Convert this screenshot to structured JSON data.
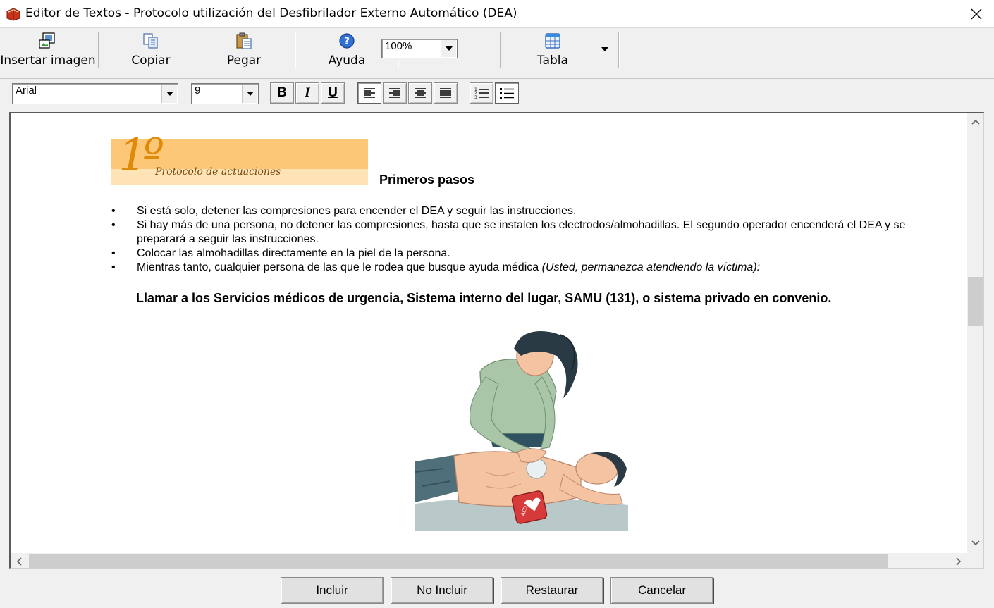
{
  "window": {
    "title": "Editor de Textos - Protocolo utilización del Desfibrilador Externo Automático (DEA)",
    "close_icon": "close-icon"
  },
  "toolbar": {
    "insert_image_label": "Insertar imagen",
    "copy_label": "Copiar",
    "paste_label": "Pegar",
    "help_label": "Ayuda",
    "zoom_value": "100%",
    "table_label": "Tabla"
  },
  "format": {
    "font_family": "Arial",
    "font_size": "9",
    "bold_label": "B",
    "italic_label": "I",
    "underline_label": "U"
  },
  "document": {
    "banner_number": "1º",
    "banner_subtitle": "Protocolo de actuaciones",
    "heading": "Primeros pasos",
    "bullets": [
      "Si está solo, detener las compresiones para encender el DEA y seguir las instrucciones.",
      "Si hay más de una persona, no detener las compresiones, hasta que se instalen los electrodos/almohadillas. El segundo operador encenderá el DEA y se preparará a seguir las instrucciones.",
      "Colocar las almohadillas directamente en la piel de la persona."
    ],
    "bullet4_text": "Mientras tanto, cualquier persona de las que le rodea que busque ayuda médica ",
    "bullet4_italic": "(Usted, permanezca atendiendo la víctima):",
    "call_heading": "Llamar a los Servicios médicos de urgencia, Sistema interno del lugar, SAMU (131), o sistema privado en convenio.",
    "aed_label": "AED"
  },
  "buttons": {
    "include": "Incluir",
    "not_include": "No Incluir",
    "restore": "Restaurar",
    "cancel": "Cancelar"
  },
  "colors": {
    "banner": "#fcc776",
    "accent_orange": "#e08a0c",
    "window_bg": "#f0f0f0"
  }
}
